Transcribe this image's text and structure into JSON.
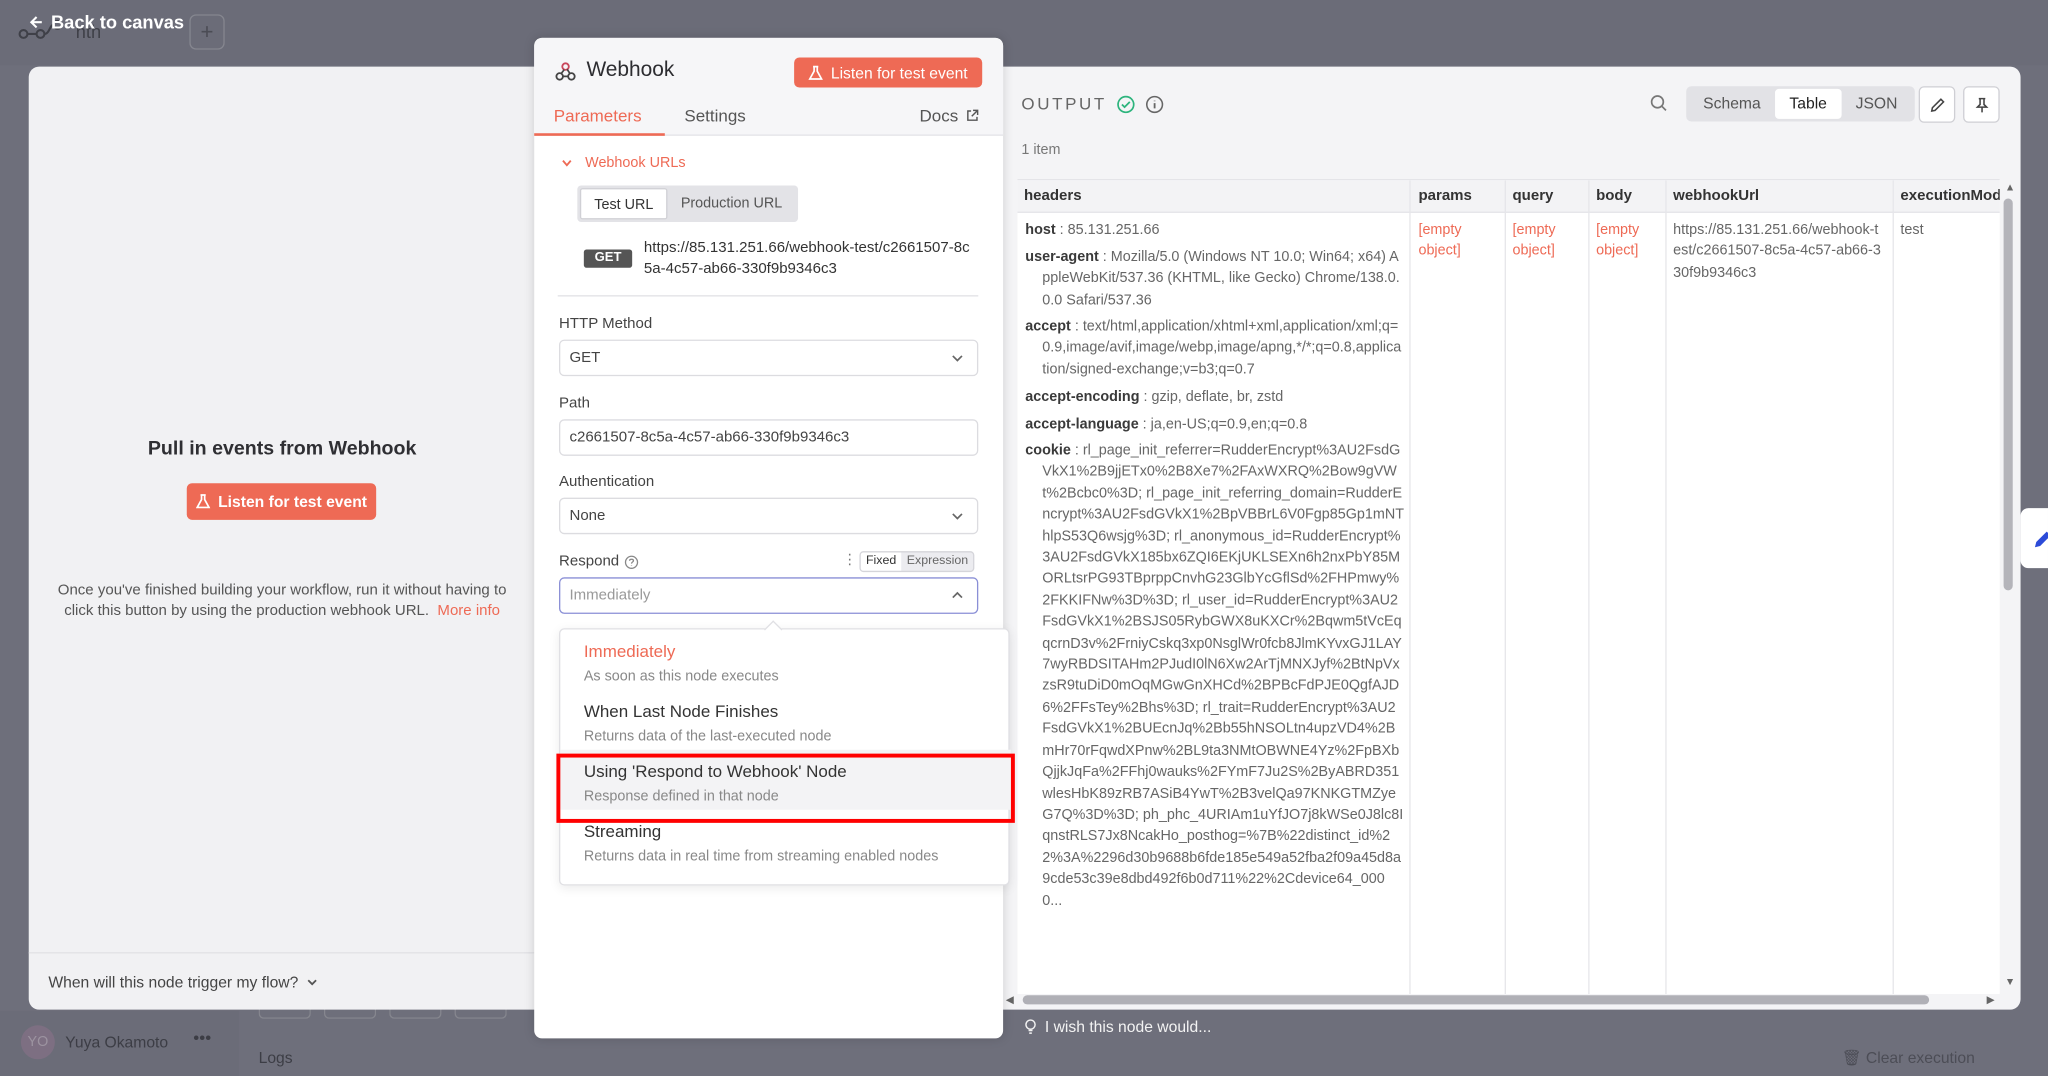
{
  "background": {
    "back_link": "Back to canvas",
    "workflow_name": "nth",
    "plus_label": "+",
    "user_initials": "YO",
    "user_name": "Yuya Okamoto",
    "logs_label": "Logs",
    "clear_execution_label": "Clear execution"
  },
  "left_pane": {
    "title": "Pull in events from Webhook",
    "listen_button": "Listen for test event",
    "description": "Once you've finished building your workflow, run it without having to click this button by using the production webhook URL.",
    "more_info": "More info",
    "trigger_question": "When will this node trigger my flow?"
  },
  "node_panel": {
    "title": "Webhook",
    "listen_button": "Listen for test event",
    "tabs": [
      {
        "label": "Parameters",
        "active": true
      },
      {
        "label": "Settings",
        "active": false
      }
    ],
    "docs_label": "Docs",
    "webhook_urls_label": "Webhook URLs",
    "url_toggle": [
      {
        "label": "Test URL",
        "active": true
      },
      {
        "label": "Production URL",
        "active": false
      }
    ],
    "method_badge": "GET",
    "test_url": "https://85.131.251.66/webhook-test/c2661507-8c5a-4c57-ab66-330f9b9346c3",
    "http_method": {
      "label": "HTTP Method",
      "value": "GET"
    },
    "path": {
      "label": "Path",
      "value": "c2661507-8c5a-4c57-ab66-330f9b9346c3"
    },
    "authentication": {
      "label": "Authentication",
      "value": "None"
    },
    "respond": {
      "label": "Respond",
      "placeholder": "Immediately",
      "mode_toggle": [
        {
          "label": "Fixed",
          "active": true
        },
        {
          "label": "Expression",
          "active": false
        }
      ],
      "options": [
        {
          "title": "Immediately",
          "description": "As soon as this node executes",
          "selected": true
        },
        {
          "title": "When Last Node Finishes",
          "description": "Returns data of the last-executed node",
          "selected": false
        },
        {
          "title": "Using 'Respond to Webhook' Node",
          "description": "Response defined in that node",
          "selected": false,
          "hovered": true
        },
        {
          "title": "Streaming",
          "description": "Returns data in real time from streaming enabled nodes",
          "selected": false
        }
      ]
    }
  },
  "output": {
    "title": "OUTPUT",
    "item_count": "1 item",
    "views": [
      {
        "label": "Schema",
        "active": false
      },
      {
        "label": "Table",
        "active": true
      },
      {
        "label": "JSON",
        "active": false
      }
    ],
    "columns": [
      "headers",
      "params",
      "query",
      "body",
      "webhookUrl",
      "executionMod"
    ],
    "headers": [
      {
        "key": "host",
        "value": "85.131.251.66"
      },
      {
        "key": "user-agent",
        "value": "Mozilla/5.0 (Windows NT 10.0; Win64; x64) AppleWebKit/537.36 (KHTML, like Gecko) Chrome/138.0.0.0 Safari/537.36"
      },
      {
        "key": "accept",
        "value": "text/html,application/xhtml+xml,application/xml;q=0.9,image/avif,image/webp,image/apng,*/*;q=0.8,application/signed-exchange;v=b3;q=0.7"
      },
      {
        "key": "accept-encoding",
        "value": "gzip, deflate, br, zstd"
      },
      {
        "key": "accept-language",
        "value": "ja,en-US;q=0.9,en;q=0.8"
      },
      {
        "key": "cookie",
        "value": "rl_page_init_referrer=RudderEncrypt%3AU2FsdGVkX1%2B9jjETx0%2B8Xe7%2FAxWXRQ%2Bow9gVWt%2Bcbc0%3D; rl_page_init_referring_domain=RudderEncrypt%3AU2FsdGVkX1%2BpVBBrL6V0Fgp85Gp1mNThlpS53Q6wsjg%3D; rl_anonymous_id=RudderEncrypt%3AU2FsdGVkX185bx6ZQI6EKjUKLSEXn6h2nxPbY85MORLtsrPG93TBprppCnvhG23GlbYcGflSd%2FHPmwy%2FKKIFNw%3D%3D; rl_user_id=RudderEncrypt%3AU2FsdGVkX1%2BSJS05RybGWX8uKXCr%2Bqwm5tVcEqqcrnD3v%2FrniyCskq3xp0NsglWr0fcb8JlmKYvxGJ1LAY7wyRBDSITAHm2PJudI0lN6Xw2ArTjMNXJyf%2BtNpVxzsR9tuDiD0mOqMGwGnXHCd%2BPBcFdPJE0QgfAJD6%2FFsTey%2Bhs%3D; rl_trait=RudderEncrypt%3AU2FsdGVkX1%2BUEcnJq%2Bb55hNSOLtn4upzVD4%2BmHr70rFqwdXPnw%2BL9ta3NMtOBWNE4Yz%2FpBXbQjjkJqFa%2FFhj0wauks%2FYmF7Ju2S%2ByABRD351wlesHbK89zRB7ASiB4YwT%2B3velQa97KNKGTMZyeG7Q%3D%3D; ph_phc_4URIAm1uYfJO7j8kWSe0J8lc8IqnstRLS7Jx8NcakHo_posthog=%7B%22distinct_id%22%3A%2296d30b9688b6fde185e549a52fba2f09a45d8a9cde53c39e8dbd492f6b0d711%22%2Cdevice64_0000..."
      }
    ],
    "params": "[empty object]",
    "query": "[empty object]",
    "body": "[empty object]",
    "webhook_url": "https://85.131.251.66/webhook-test/c2661507-8c5a-4c57-ab66-330f9b9346c3",
    "execution_mode": "test",
    "wish_label": "I wish this node would..."
  }
}
